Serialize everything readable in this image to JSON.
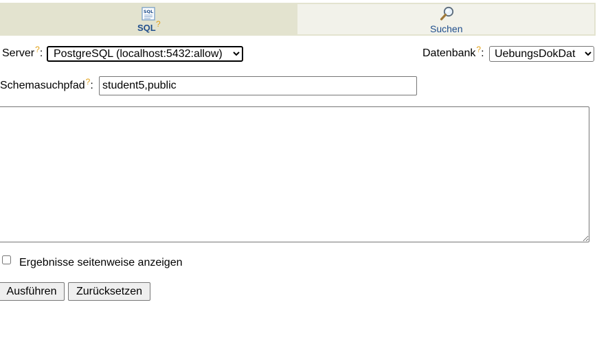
{
  "tabs": {
    "sql": {
      "label": "SQL",
      "help": "?",
      "icon": "sql-document-icon"
    },
    "search": {
      "label": "Suchen",
      "icon": "magnifier-icon"
    }
  },
  "form": {
    "server_label": "Server",
    "server_help": "?",
    "server_value": "PostgreSQL (localhost:5432:allow)",
    "database_label": "Datenbank",
    "database_help": "?",
    "database_value": "UebungsDokDat",
    "schema_label": "Schemasuchpfad",
    "schema_help": "?",
    "schema_value": "student5,public",
    "query_value": "",
    "paginate_label": "Ergebnisse seitenweise anzeigen",
    "paginate_checked": false,
    "run_label": "Ausführen",
    "reset_label": "Zurücksetzen"
  },
  "colors": {
    "tab_active_bg": "#e3e3cf",
    "tab_inactive_bg": "#f2f2ea",
    "link_blue": "#1f4e8c",
    "help_orange": "#e2a21a"
  }
}
